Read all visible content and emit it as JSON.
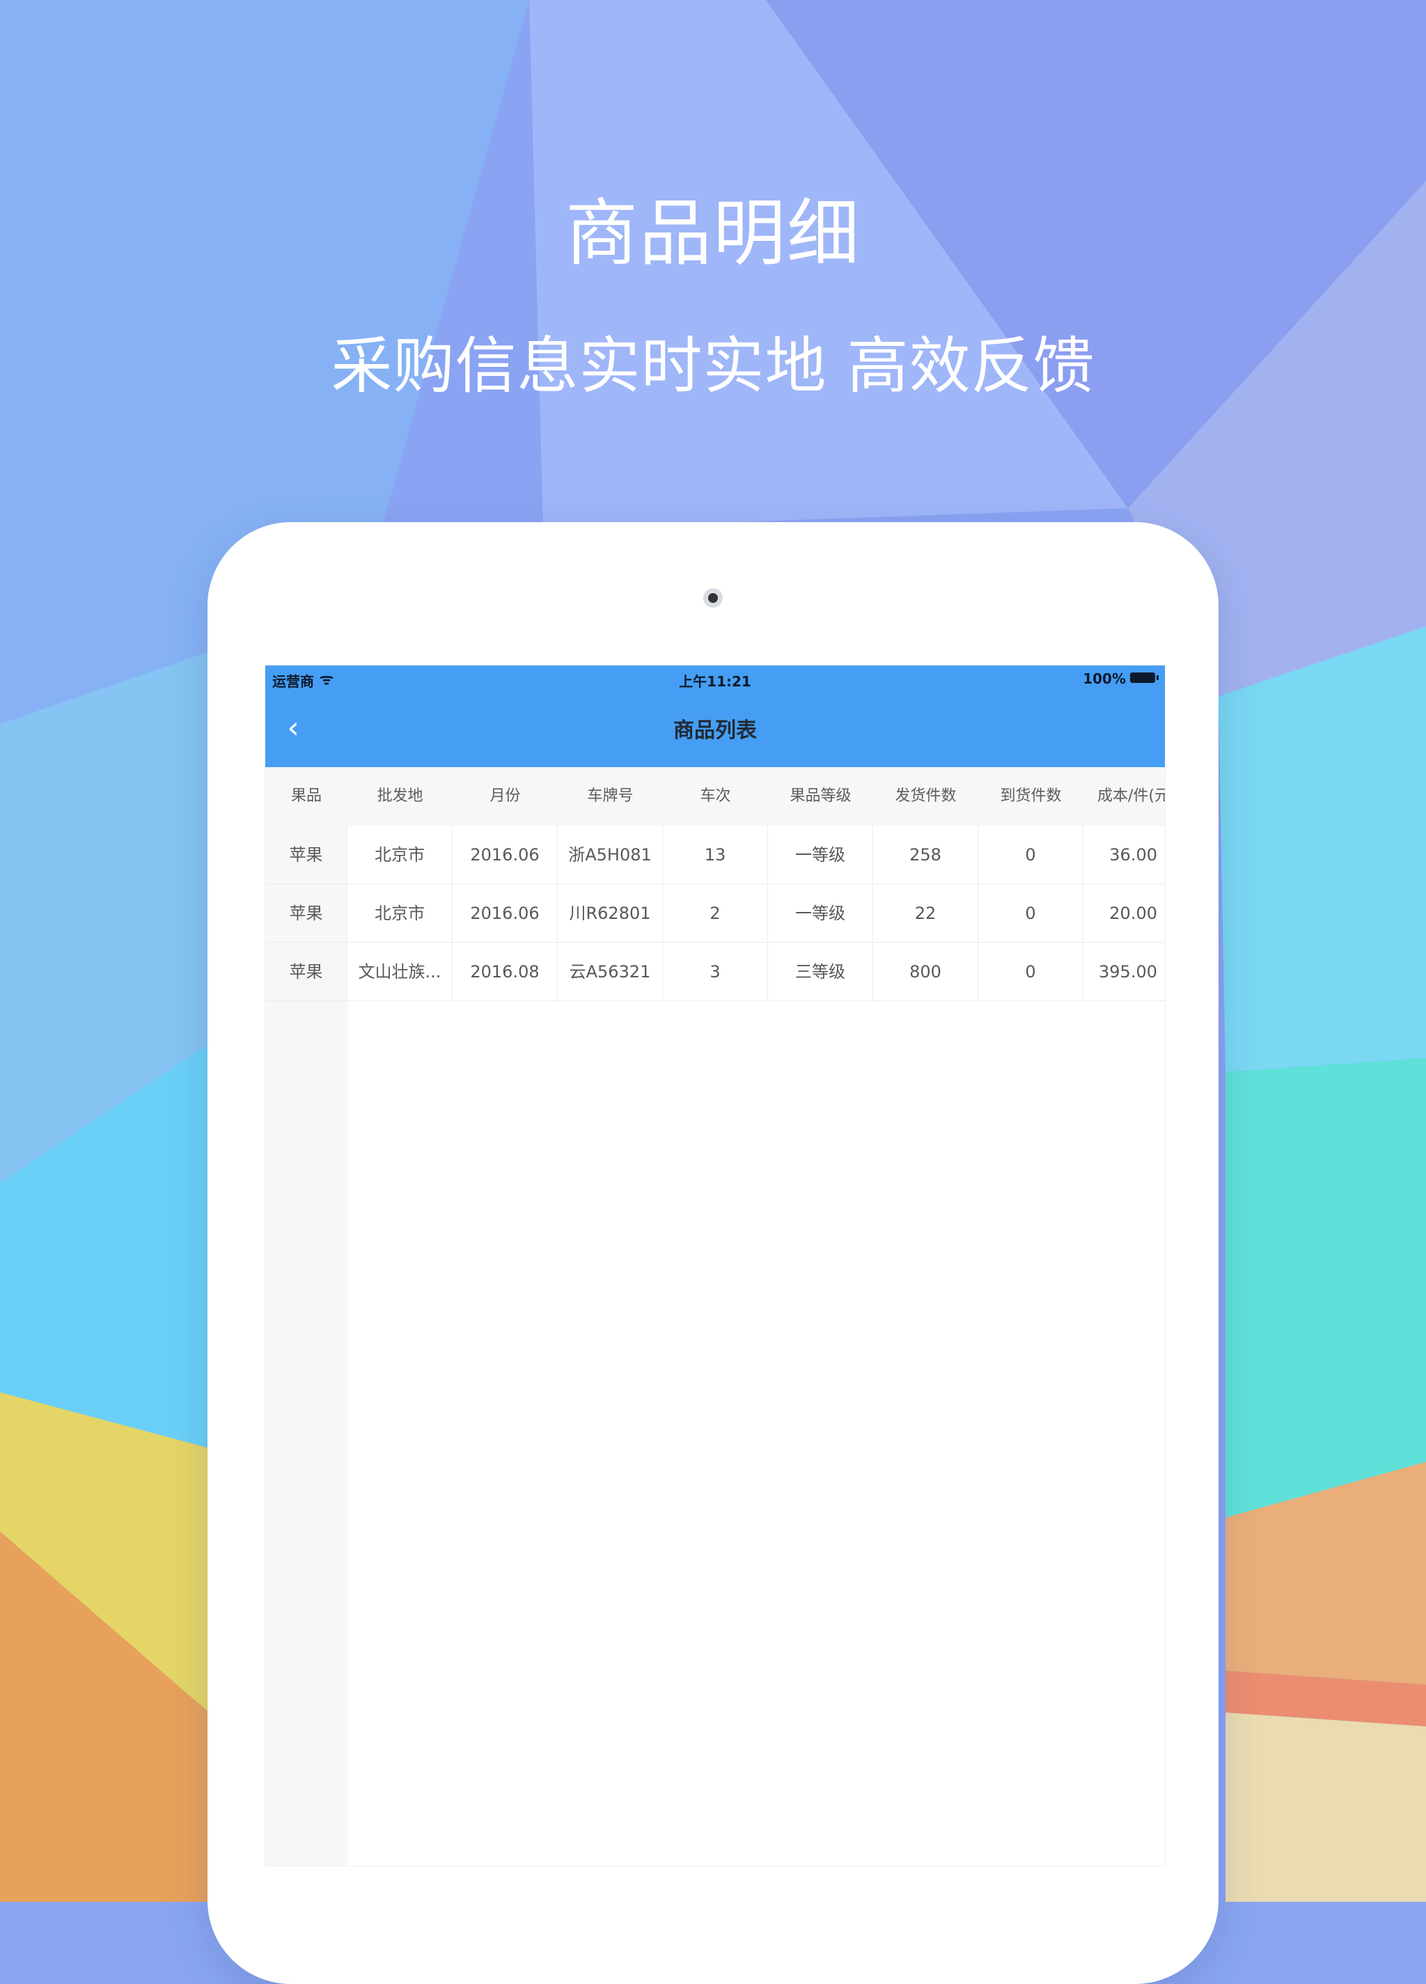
{
  "promo": {
    "title": "商品明细",
    "subtitle": "采购信息实时实地 高效反馈"
  },
  "statusbar": {
    "carrier": "运营商",
    "time": "上午11:21",
    "battery": "100%"
  },
  "navbar": {
    "back": "‹",
    "title": "商品列表"
  },
  "table": {
    "columns": [
      "果品",
      "批发地",
      "月份",
      "车牌号",
      "车次",
      "果品等级",
      "发货件数",
      "到货件数",
      "成本/件(元"
    ],
    "rows": [
      [
        "苹果",
        "北京市",
        "2016.06",
        "浙A5H081",
        "13",
        "一等级",
        "258",
        "0",
        "36.00"
      ],
      [
        "苹果",
        "北京市",
        "2016.06",
        "川R62801",
        "2",
        "一等级",
        "22",
        "0",
        "20.00"
      ],
      [
        "苹果",
        "文山壮族...",
        "2016.08",
        "云A56321",
        "3",
        "三等级",
        "800",
        "0",
        "395.00"
      ]
    ]
  },
  "colors": {
    "navbar": "#459ef3",
    "background_top": "#8aa6f2",
    "background_bottom_left": "#e8a15a"
  },
  "icons": {
    "wifi": "wifi-icon",
    "battery": "battery-icon",
    "back": "chevron-left-icon",
    "camera": "camera-icon"
  }
}
